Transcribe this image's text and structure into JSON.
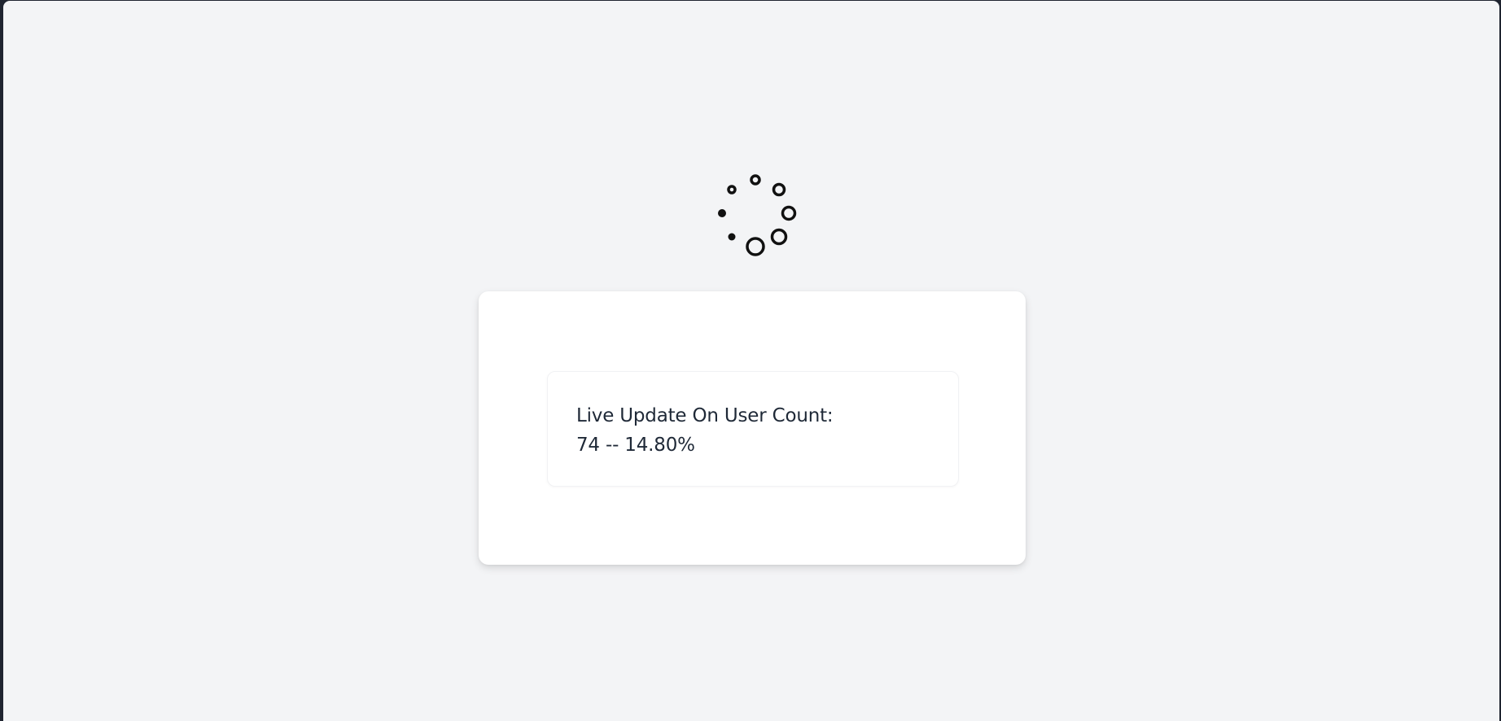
{
  "status": {
    "title": "Live Update On User Count:",
    "value": "74 -- 14.80%"
  },
  "spinner": {
    "icon": "loading-spinner-icon",
    "color": "#111111"
  },
  "colors": {
    "page_background": "#f3f4f6",
    "card_background": "#ffffff",
    "text": "#1f2937"
  }
}
